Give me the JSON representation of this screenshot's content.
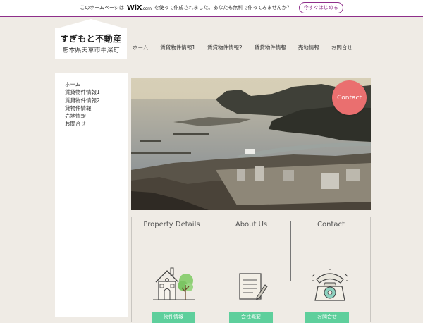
{
  "banner": {
    "text_before": "このホームページは",
    "wix_logo": "WiX",
    "wix_suffix": ".com",
    "text_after": "を使って作成されました。あなたも無料で作ってみませんか？",
    "cta_label": "今すぐはじめる"
  },
  "logo": {
    "name": "すぎもと不動産",
    "address": "熊本県天草市牛深町"
  },
  "nav": {
    "items": [
      "ホーム",
      "賃貸物件情報1",
      "賃貸物件情報2",
      "賃貸物件情報",
      "売地情報",
      "お問合せ"
    ]
  },
  "sidebar": {
    "items": [
      "ホーム",
      "賃貸物件情報1",
      "賃貸物件情報2",
      "貸物件情報",
      "売地情報",
      "お問合せ"
    ]
  },
  "hero": {
    "contact_label": "Contact"
  },
  "panel": {
    "columns": [
      {
        "title": "Property Details",
        "icon": "house-icon",
        "button_label": "物件情報"
      },
      {
        "title": "About Us",
        "icon": "document-icon",
        "button_label": "会社概要"
      },
      {
        "title": "Contact",
        "icon": "telephone-icon",
        "button_label": "お問合せ"
      }
    ]
  },
  "colors": {
    "background": "#efebe5",
    "banner_accent": "#8e2f8a",
    "contact_button": "#ea6f6f",
    "green_button": "#5ecf9c"
  }
}
